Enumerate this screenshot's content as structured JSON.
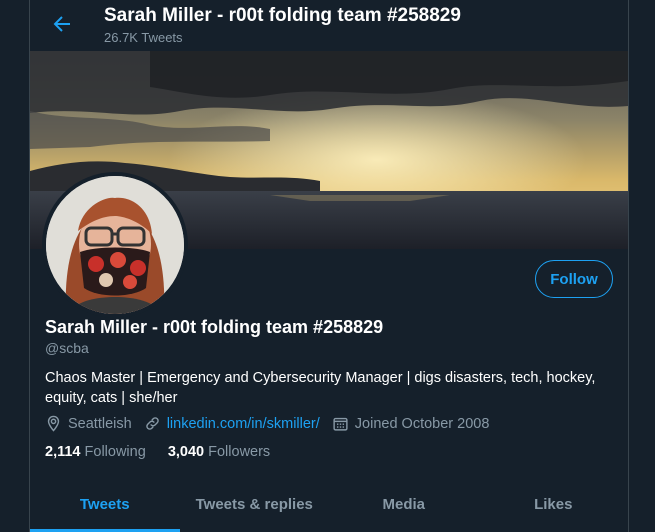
{
  "header": {
    "title": "Sarah Miller - r00t folding team #258829",
    "tweet_count": "26.7K Tweets"
  },
  "profile": {
    "name": "Sarah Miller - r00t folding team #258829",
    "handle": "@scba",
    "bio": "Chaos Master | Emergency and Cybersecurity Manager |  digs disasters, tech, hockey, equity, cats | she/her",
    "location": "Seattleish",
    "link": "linkedin.com/in/skmiller/",
    "joined": "Joined October 2008",
    "following_count": "2,114",
    "following_label": "Following",
    "followers_count": "3,040",
    "followers_label": "Followers",
    "follow_button": "Follow"
  },
  "tabs": [
    {
      "label": "Tweets",
      "active": true
    },
    {
      "label": "Tweets & replies",
      "active": false
    },
    {
      "label": "Media",
      "active": false
    },
    {
      "label": "Likes",
      "active": false
    }
  ],
  "icons": {
    "back": "back-arrow-icon",
    "location": "location-pin-icon",
    "link": "link-icon",
    "calendar": "calendar-icon"
  },
  "colors": {
    "background": "#15202b",
    "accent": "#1da1f2",
    "secondary_text": "#8899a6",
    "border": "#38444d"
  }
}
